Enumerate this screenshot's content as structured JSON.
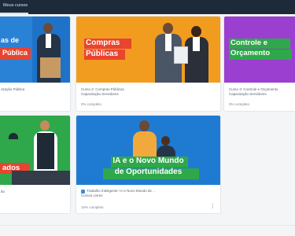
{
  "topbar": {
    "tab_label": "Meus cursos"
  },
  "courses": [
    {
      "banner_title_line1": "as de",
      "banner_title_line2": "Pública",
      "banner_color": "#1e73c8",
      "title": "citação Pública",
      "category": "",
      "progress_text": ""
    },
    {
      "banner_title_line1": "Compras",
      "banner_title_line2": "Públicas",
      "banner_color": "#f29c1f",
      "title": "Curso 2: Compras Públicas",
      "category": "Capacitação Servidores",
      "progress_text": "0% completo"
    },
    {
      "banner_title_line1": "Controle e",
      "banner_title_line2": "Orçamento",
      "banner_color": "#9b3fd0",
      "title": "Curso 3: Controle e Orçamento",
      "category": "Capacitação Servidores",
      "progress_text": "0% completo"
    },
    {
      "banner_title_line1": "ados",
      "banner_title_line2": "",
      "banner_color": "#2ea84a",
      "title": "ão",
      "category": "",
      "progress_text": ""
    },
    {
      "banner_title_line1": "IA e o Novo Mundo",
      "banner_title_line2": "de Oportunidades",
      "banner_color": "#1f7bd2",
      "title": "Trabalho Inteligente: IA e Novo Mundo de ...",
      "category": "Cursos Livres",
      "progress_text": "15% completo"
    }
  ],
  "colors": {
    "topbar": "#1d2a3a",
    "blue": "#1e73c8",
    "orange": "#f29c1f",
    "purple": "#9b3fd0",
    "green": "#2ea84a",
    "red_label": "#e8442f",
    "green_label": "#2ea84a"
  },
  "icons": {
    "menu": "vertical-dots-icon",
    "course_type": "book-icon"
  }
}
